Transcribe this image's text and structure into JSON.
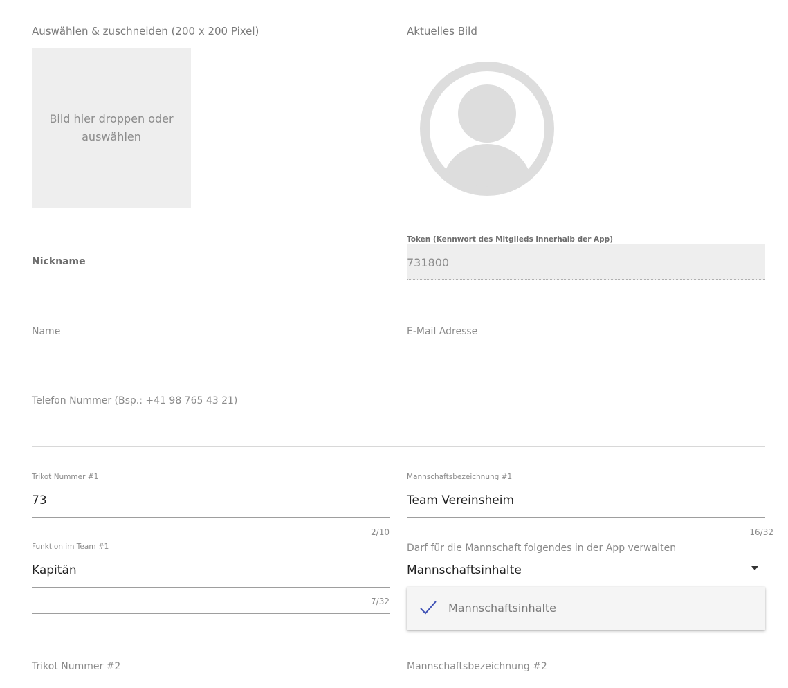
{
  "image_section": {
    "select_label": "Auswählen & zuschneiden (200 x 200 Pixel)",
    "dropzone_text": "Bild hier droppen oder auswählen",
    "current_label": "Aktuelles Bild",
    "avatar_icon": "user-placeholder-icon"
  },
  "fields": {
    "nickname_label": "Nickname",
    "token_label": "Token (Kennwort des Mitglieds innerhalb der App)",
    "token_value": "731800",
    "name_label": "Name",
    "email_label": "E-Mail Adresse",
    "phone_label": "Telefon Nummer (Bsp.: +41 98 765 43 21)"
  },
  "team1": {
    "jersey_label": "Trikot Nummer #1",
    "jersey_value": "73",
    "jersey_counter": "2/10",
    "team_label": "Mannschaftsbezeichnung #1",
    "team_value": "Team Vereinsheim",
    "team_counter": "16/32",
    "function_label": "Funktion im Team #1",
    "function_value": "Kapitän",
    "function_counter": "7/32",
    "manage_label": "Darf für die Mannschaft folgendes in der App verwalten",
    "manage_value": "Mannschaftsinhalte",
    "dropdown_icon": "caret-down-icon"
  },
  "dropdown_menu": {
    "options": [
      {
        "label": "Mannschaftsinhalte",
        "selected": true,
        "icon": "check-icon"
      }
    ]
  },
  "team2": {
    "jersey_label": "Trikot Nummer #2",
    "team_label": "Mannschaftsbezeichnung #2"
  },
  "colors": {
    "accent_check": "#3f51b5",
    "placeholder_gray": "#dddddd"
  }
}
